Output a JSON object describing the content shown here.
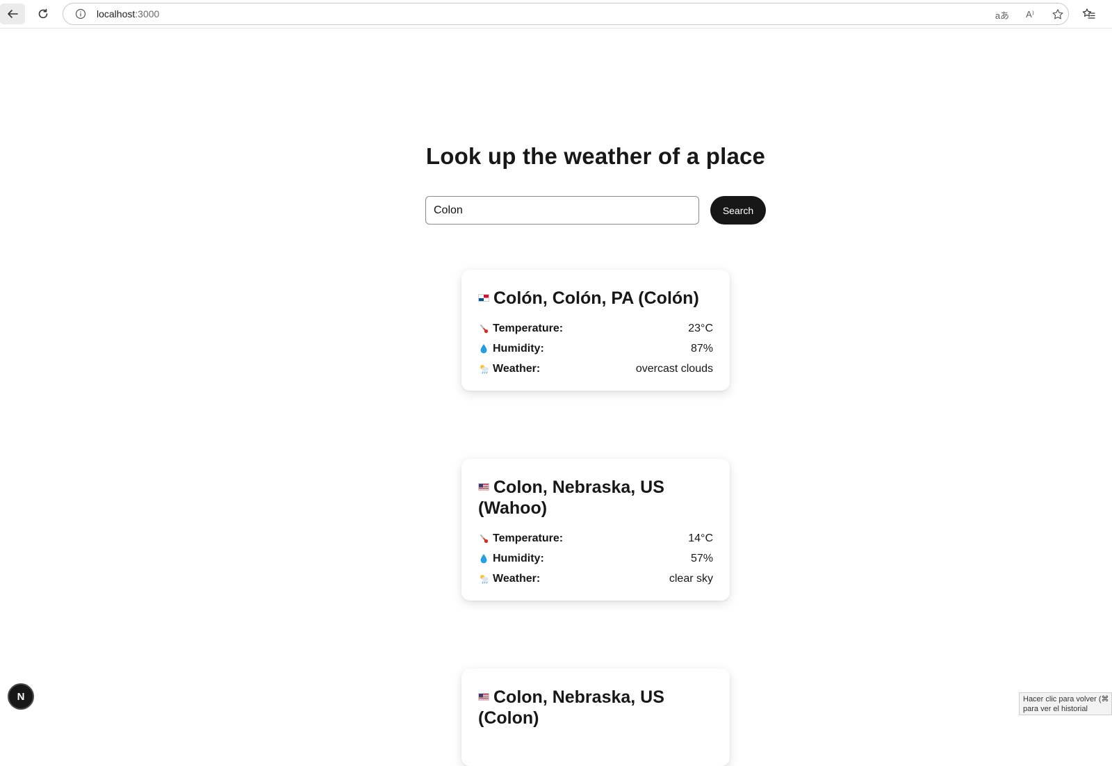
{
  "browser": {
    "url_host": "localhost",
    "url_port": ":3000",
    "translate_glyph": "aあ",
    "read_aloud_glyph": "A⁾"
  },
  "page": {
    "title": "Look up the weather of a place"
  },
  "search": {
    "value": "Colon",
    "button_label": "Search"
  },
  "labels": {
    "temperature": "Temperature:",
    "humidity": "Humidity:",
    "weather": "Weather:"
  },
  "results": [
    {
      "name": "Colón, Colón, PA (Colón)",
      "flag": "PA",
      "temperature": "23°C",
      "humidity": "87%",
      "weather": "overcast clouds"
    },
    {
      "name": "Colon, Nebraska, US (Wahoo)",
      "flag": "US",
      "temperature": "14°C",
      "humidity": "57%",
      "weather": "clear sky"
    },
    {
      "name": "Colon, Nebraska, US (Colon)",
      "flag": "US"
    }
  ],
  "devtools": {
    "badge_letter": "N"
  },
  "tooltip": {
    "line1": "Hacer clic para volver (⌘",
    "line2": "para ver el historial"
  },
  "icons": {
    "temperature": "thermometer-icon",
    "humidity": "droplet-icon",
    "weather": "sun-behind-rain-cloud-icon"
  }
}
